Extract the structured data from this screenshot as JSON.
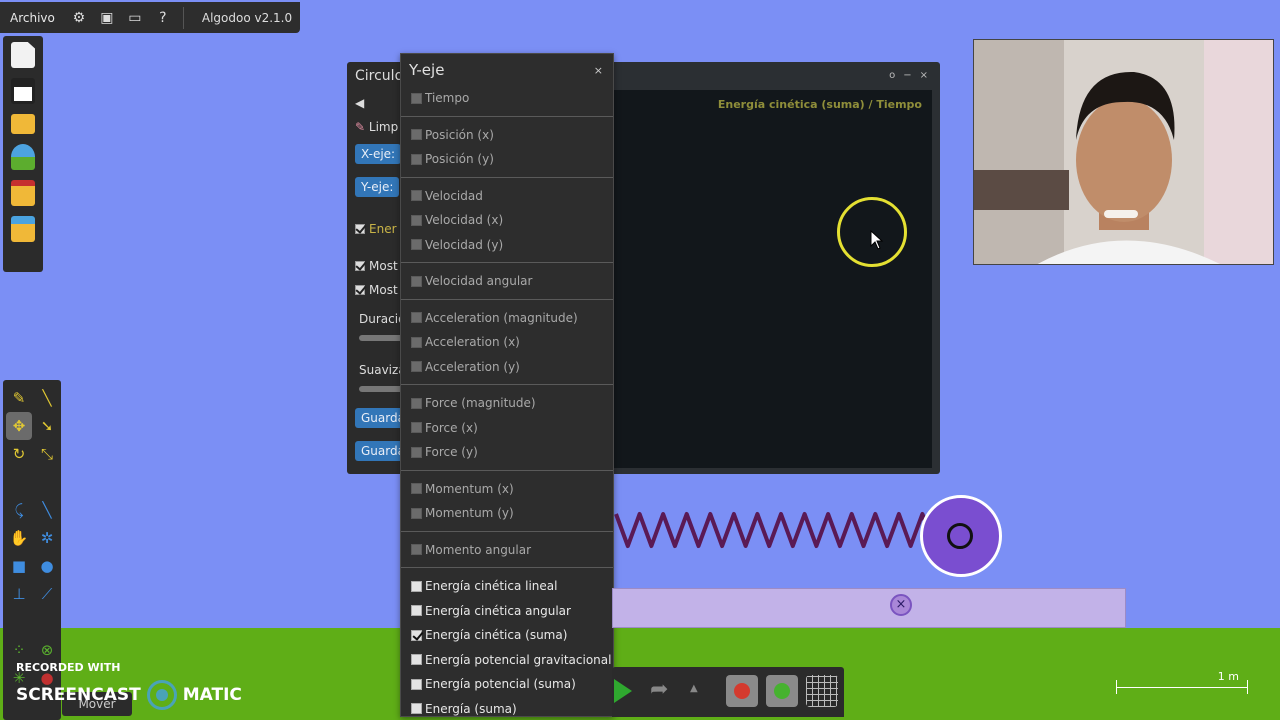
{
  "topbar": {
    "menu_label": "Archivo",
    "version": "Algodoo v2.1.0",
    "help_label": "?"
  },
  "prop_panel": {
    "title": "Circulo",
    "clear_label": "Limp",
    "x_axis_label": "X-eje:",
    "y_axis_label": "Y-eje:",
    "energy_label": "Ener",
    "show1_label": "Most",
    "show2_label": "Most",
    "duration_label": "Duració",
    "smooth_label": "Suaviza",
    "save1_label": "Guarda",
    "save2_label": "Guarda"
  },
  "graph": {
    "title": "Energía cinética (suma) / Tiempo",
    "window_controls": [
      "o",
      "−",
      "×"
    ]
  },
  "dropdown": {
    "title": "Y-eje",
    "close": "×",
    "groups": [
      [
        {
          "label": "Tiempo",
          "checked": false,
          "bright": false
        }
      ],
      [
        {
          "label": "Posición (x)",
          "checked": false,
          "bright": false
        },
        {
          "label": "Posición (y)",
          "checked": false,
          "bright": false
        }
      ],
      [
        {
          "label": "Velocidad",
          "checked": false,
          "bright": false
        },
        {
          "label": "Velocidad (x)",
          "checked": false,
          "bright": false
        },
        {
          "label": "Velocidad (y)",
          "checked": false,
          "bright": false
        }
      ],
      [
        {
          "label": "Velocidad angular",
          "checked": false,
          "bright": false
        }
      ],
      [
        {
          "label": "Acceleration (magnitude)",
          "checked": false,
          "bright": false
        },
        {
          "label": "Acceleration (x)",
          "checked": false,
          "bright": false
        },
        {
          "label": "Acceleration (y)",
          "checked": false,
          "bright": false
        }
      ],
      [
        {
          "label": "Force (magnitude)",
          "checked": false,
          "bright": false
        },
        {
          "label": "Force (x)",
          "checked": false,
          "bright": false
        },
        {
          "label": "Force (y)",
          "checked": false,
          "bright": false
        }
      ],
      [
        {
          "label": "Momentum (x)",
          "checked": false,
          "bright": false
        },
        {
          "label": "Momentum (y)",
          "checked": false,
          "bright": false
        }
      ],
      [
        {
          "label": "Momento angular",
          "checked": false,
          "bright": false
        }
      ],
      [
        {
          "label": "Energía cinética lineal",
          "checked": false,
          "bright": true
        },
        {
          "label": "Energía cinética angular",
          "checked": false,
          "bright": true
        },
        {
          "label": "Energía cinética (suma)",
          "checked": true,
          "bright": true
        },
        {
          "label": "Energía potencial gravitacional",
          "checked": false,
          "bright": true
        },
        {
          "label": "Energía potencial (suma)",
          "checked": false,
          "bright": true
        },
        {
          "label": "Energía (suma)",
          "checked": false,
          "bright": true
        }
      ]
    ]
  },
  "tools": {
    "mover_label": "Mover"
  },
  "scale_label": "1 m",
  "watermark": {
    "line1": "RECORDED WITH",
    "line2a": "SCREENCAST",
    "line2b": "MATIC"
  },
  "colors": {
    "sky": "#7b8ff5",
    "ground": "#5fae17",
    "panel": "#2b2b2b",
    "accent_button": "#3276b8",
    "graph_title": "#8f8e3a",
    "ball": "#7a4ed0"
  }
}
